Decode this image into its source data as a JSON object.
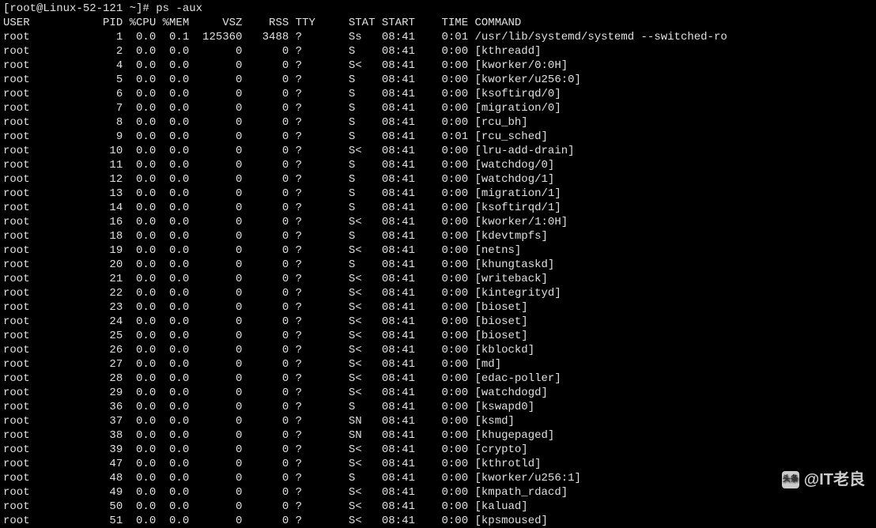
{
  "prompt": "[root@Linux-52-121 ~]# ps -aux",
  "headers": {
    "user": "USER",
    "pid": "PID",
    "cpu": "%CPU",
    "mem": "%MEM",
    "vsz": "VSZ",
    "rss": "RSS",
    "tty": "TTY",
    "stat": "STAT",
    "start": "START",
    "time": "TIME",
    "command": "COMMAND"
  },
  "processes": [
    {
      "user": "root",
      "pid": "1",
      "cpu": "0.0",
      "mem": "0.1",
      "vsz": "125360",
      "rss": "3488",
      "tty": "?",
      "stat": "Ss",
      "start": "08:41",
      "time": "0:01",
      "command": "/usr/lib/systemd/systemd --switched-ro"
    },
    {
      "user": "root",
      "pid": "2",
      "cpu": "0.0",
      "mem": "0.0",
      "vsz": "0",
      "rss": "0",
      "tty": "?",
      "stat": "S",
      "start": "08:41",
      "time": "0:00",
      "command": "[kthreadd]"
    },
    {
      "user": "root",
      "pid": "4",
      "cpu": "0.0",
      "mem": "0.0",
      "vsz": "0",
      "rss": "0",
      "tty": "?",
      "stat": "S<",
      "start": "08:41",
      "time": "0:00",
      "command": "[kworker/0:0H]"
    },
    {
      "user": "root",
      "pid": "5",
      "cpu": "0.0",
      "mem": "0.0",
      "vsz": "0",
      "rss": "0",
      "tty": "?",
      "stat": "S",
      "start": "08:41",
      "time": "0:00",
      "command": "[kworker/u256:0]"
    },
    {
      "user": "root",
      "pid": "6",
      "cpu": "0.0",
      "mem": "0.0",
      "vsz": "0",
      "rss": "0",
      "tty": "?",
      "stat": "S",
      "start": "08:41",
      "time": "0:00",
      "command": "[ksoftirqd/0]"
    },
    {
      "user": "root",
      "pid": "7",
      "cpu": "0.0",
      "mem": "0.0",
      "vsz": "0",
      "rss": "0",
      "tty": "?",
      "stat": "S",
      "start": "08:41",
      "time": "0:00",
      "command": "[migration/0]"
    },
    {
      "user": "root",
      "pid": "8",
      "cpu": "0.0",
      "mem": "0.0",
      "vsz": "0",
      "rss": "0",
      "tty": "?",
      "stat": "S",
      "start": "08:41",
      "time": "0:00",
      "command": "[rcu_bh]"
    },
    {
      "user": "root",
      "pid": "9",
      "cpu": "0.0",
      "mem": "0.0",
      "vsz": "0",
      "rss": "0",
      "tty": "?",
      "stat": "S",
      "start": "08:41",
      "time": "0:01",
      "command": "[rcu_sched]"
    },
    {
      "user": "root",
      "pid": "10",
      "cpu": "0.0",
      "mem": "0.0",
      "vsz": "0",
      "rss": "0",
      "tty": "?",
      "stat": "S<",
      "start": "08:41",
      "time": "0:00",
      "command": "[lru-add-drain]"
    },
    {
      "user": "root",
      "pid": "11",
      "cpu": "0.0",
      "mem": "0.0",
      "vsz": "0",
      "rss": "0",
      "tty": "?",
      "stat": "S",
      "start": "08:41",
      "time": "0:00",
      "command": "[watchdog/0]"
    },
    {
      "user": "root",
      "pid": "12",
      "cpu": "0.0",
      "mem": "0.0",
      "vsz": "0",
      "rss": "0",
      "tty": "?",
      "stat": "S",
      "start": "08:41",
      "time": "0:00",
      "command": "[watchdog/1]"
    },
    {
      "user": "root",
      "pid": "13",
      "cpu": "0.0",
      "mem": "0.0",
      "vsz": "0",
      "rss": "0",
      "tty": "?",
      "stat": "S",
      "start": "08:41",
      "time": "0:00",
      "command": "[migration/1]"
    },
    {
      "user": "root",
      "pid": "14",
      "cpu": "0.0",
      "mem": "0.0",
      "vsz": "0",
      "rss": "0",
      "tty": "?",
      "stat": "S",
      "start": "08:41",
      "time": "0:00",
      "command": "[ksoftirqd/1]"
    },
    {
      "user": "root",
      "pid": "16",
      "cpu": "0.0",
      "mem": "0.0",
      "vsz": "0",
      "rss": "0",
      "tty": "?",
      "stat": "S<",
      "start": "08:41",
      "time": "0:00",
      "command": "[kworker/1:0H]"
    },
    {
      "user": "root",
      "pid": "18",
      "cpu": "0.0",
      "mem": "0.0",
      "vsz": "0",
      "rss": "0",
      "tty": "?",
      "stat": "S",
      "start": "08:41",
      "time": "0:00",
      "command": "[kdevtmpfs]"
    },
    {
      "user": "root",
      "pid": "19",
      "cpu": "0.0",
      "mem": "0.0",
      "vsz": "0",
      "rss": "0",
      "tty": "?",
      "stat": "S<",
      "start": "08:41",
      "time": "0:00",
      "command": "[netns]"
    },
    {
      "user": "root",
      "pid": "20",
      "cpu": "0.0",
      "mem": "0.0",
      "vsz": "0",
      "rss": "0",
      "tty": "?",
      "stat": "S",
      "start": "08:41",
      "time": "0:00",
      "command": "[khungtaskd]"
    },
    {
      "user": "root",
      "pid": "21",
      "cpu": "0.0",
      "mem": "0.0",
      "vsz": "0",
      "rss": "0",
      "tty": "?",
      "stat": "S<",
      "start": "08:41",
      "time": "0:00",
      "command": "[writeback]"
    },
    {
      "user": "root",
      "pid": "22",
      "cpu": "0.0",
      "mem": "0.0",
      "vsz": "0",
      "rss": "0",
      "tty": "?",
      "stat": "S<",
      "start": "08:41",
      "time": "0:00",
      "command": "[kintegrityd]"
    },
    {
      "user": "root",
      "pid": "23",
      "cpu": "0.0",
      "mem": "0.0",
      "vsz": "0",
      "rss": "0",
      "tty": "?",
      "stat": "S<",
      "start": "08:41",
      "time": "0:00",
      "command": "[bioset]"
    },
    {
      "user": "root",
      "pid": "24",
      "cpu": "0.0",
      "mem": "0.0",
      "vsz": "0",
      "rss": "0",
      "tty": "?",
      "stat": "S<",
      "start": "08:41",
      "time": "0:00",
      "command": "[bioset]"
    },
    {
      "user": "root",
      "pid": "25",
      "cpu": "0.0",
      "mem": "0.0",
      "vsz": "0",
      "rss": "0",
      "tty": "?",
      "stat": "S<",
      "start": "08:41",
      "time": "0:00",
      "command": "[bioset]"
    },
    {
      "user": "root",
      "pid": "26",
      "cpu": "0.0",
      "mem": "0.0",
      "vsz": "0",
      "rss": "0",
      "tty": "?",
      "stat": "S<",
      "start": "08:41",
      "time": "0:00",
      "command": "[kblockd]"
    },
    {
      "user": "root",
      "pid": "27",
      "cpu": "0.0",
      "mem": "0.0",
      "vsz": "0",
      "rss": "0",
      "tty": "?",
      "stat": "S<",
      "start": "08:41",
      "time": "0:00",
      "command": "[md]"
    },
    {
      "user": "root",
      "pid": "28",
      "cpu": "0.0",
      "mem": "0.0",
      "vsz": "0",
      "rss": "0",
      "tty": "?",
      "stat": "S<",
      "start": "08:41",
      "time": "0:00",
      "command": "[edac-poller]"
    },
    {
      "user": "root",
      "pid": "29",
      "cpu": "0.0",
      "mem": "0.0",
      "vsz": "0",
      "rss": "0",
      "tty": "?",
      "stat": "S<",
      "start": "08:41",
      "time": "0:00",
      "command": "[watchdogd]"
    },
    {
      "user": "root",
      "pid": "36",
      "cpu": "0.0",
      "mem": "0.0",
      "vsz": "0",
      "rss": "0",
      "tty": "?",
      "stat": "S",
      "start": "08:41",
      "time": "0:00",
      "command": "[kswapd0]"
    },
    {
      "user": "root",
      "pid": "37",
      "cpu": "0.0",
      "mem": "0.0",
      "vsz": "0",
      "rss": "0",
      "tty": "?",
      "stat": "SN",
      "start": "08:41",
      "time": "0:00",
      "command": "[ksmd]"
    },
    {
      "user": "root",
      "pid": "38",
      "cpu": "0.0",
      "mem": "0.0",
      "vsz": "0",
      "rss": "0",
      "tty": "?",
      "stat": "SN",
      "start": "08:41",
      "time": "0:00",
      "command": "[khugepaged]"
    },
    {
      "user": "root",
      "pid": "39",
      "cpu": "0.0",
      "mem": "0.0",
      "vsz": "0",
      "rss": "0",
      "tty": "?",
      "stat": "S<",
      "start": "08:41",
      "time": "0:00",
      "command": "[crypto]"
    },
    {
      "user": "root",
      "pid": "47",
      "cpu": "0.0",
      "mem": "0.0",
      "vsz": "0",
      "rss": "0",
      "tty": "?",
      "stat": "S<",
      "start": "08:41",
      "time": "0:00",
      "command": "[kthrotld]"
    },
    {
      "user": "root",
      "pid": "48",
      "cpu": "0.0",
      "mem": "0.0",
      "vsz": "0",
      "rss": "0",
      "tty": "?",
      "stat": "S",
      "start": "08:41",
      "time": "0:00",
      "command": "[kworker/u256:1]"
    },
    {
      "user": "root",
      "pid": "49",
      "cpu": "0.0",
      "mem": "0.0",
      "vsz": "0",
      "rss": "0",
      "tty": "?",
      "stat": "S<",
      "start": "08:41",
      "time": "0:00",
      "command": "[kmpath_rdacd]"
    },
    {
      "user": "root",
      "pid": "50",
      "cpu": "0.0",
      "mem": "0.0",
      "vsz": "0",
      "rss": "0",
      "tty": "?",
      "stat": "S<",
      "start": "08:41",
      "time": "0:00",
      "command": "[kaluad]"
    },
    {
      "user": "root",
      "pid": "51",
      "cpu": "0.0",
      "mem": "0.0",
      "vsz": "0",
      "rss": "0",
      "tty": "?",
      "stat": "S<",
      "start": "08:41",
      "time": "0:00",
      "command": "[kpsmoused]"
    }
  ],
  "watermark": {
    "prefix": "头条",
    "text": "@IT老良"
  }
}
